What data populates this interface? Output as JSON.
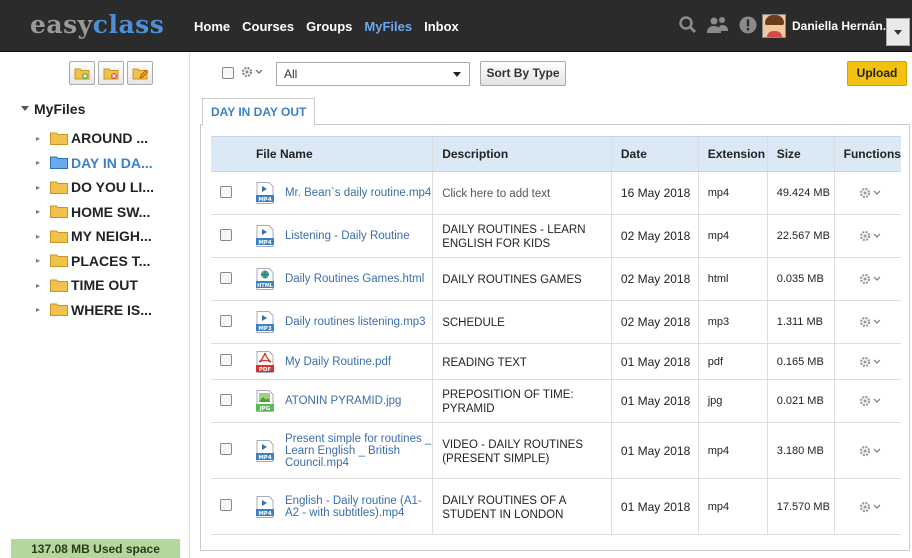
{
  "app": {
    "logo_part1": "easy",
    "logo_part2": "class",
    "nav": [
      "Home",
      "Courses",
      "Groups",
      "MyFiles",
      "Inbox"
    ],
    "active_nav": "MyFiles",
    "user_name": "Daniella Hernán..."
  },
  "sidebar": {
    "root_label": "MyFiles",
    "folders": [
      {
        "label": "AROUND ...",
        "active": false
      },
      {
        "label": "DAY IN DA...",
        "active": true
      },
      {
        "label": "DO YOU LI...",
        "active": false
      },
      {
        "label": "HOME SW...",
        "active": false
      },
      {
        "label": "MY NEIGH...",
        "active": false
      },
      {
        "label": "PLACES T...",
        "active": false
      },
      {
        "label": "TIME OUT",
        "active": false
      },
      {
        "label": "WHERE IS...",
        "active": false
      }
    ],
    "used_space": "137.08 MB Used space"
  },
  "toolbar": {
    "filter_value": "All",
    "sort_label": "Sort By Type",
    "upload_label": "Upload"
  },
  "tab": {
    "label": "DAY IN DAY OUT"
  },
  "table": {
    "headers": [
      "File Name",
      "Description",
      "Date",
      "Extension",
      "Size",
      "Functions"
    ],
    "rows": [
      {
        "name": "Mr. Bean`s daily routine.mp4",
        "description": "Click here to add text",
        "placeholder": true,
        "date": "16 May 2018",
        "ext": "mp4",
        "size": "49.424 MB",
        "icon": "mp4",
        "icon_label": "MP4"
      },
      {
        "name": "Listening - Daily Routine",
        "description": "DAILY ROUTINES - LEARN ENGLISH FOR KIDS",
        "placeholder": false,
        "date": "02 May 2018",
        "ext": "mp4",
        "size": "22.567 MB",
        "icon": "mp4",
        "icon_label": "MP4"
      },
      {
        "name": "Daily Routines Games.html",
        "description": "DAILY ROUTINES GAMES",
        "placeholder": false,
        "date": "02 May 2018",
        "ext": "html",
        "size": "0.035 MB",
        "icon": "html",
        "icon_label": "HTML"
      },
      {
        "name": "Daily routines listening.mp3",
        "description": "SCHEDULE",
        "placeholder": false,
        "date": "02 May 2018",
        "ext": "mp3",
        "size": "1.311 MB",
        "icon": "mp3",
        "icon_label": "MP3"
      },
      {
        "name": "My Daily Routine.pdf",
        "description": "READING TEXT",
        "placeholder": false,
        "date": "01 May 2018",
        "ext": "pdf",
        "size": "0.165 MB",
        "icon": "pdf",
        "icon_label": "PDF"
      },
      {
        "name": "ATONIN PYRAMID.jpg",
        "description": "PREPOSITION OF TIME: PYRAMID",
        "placeholder": false,
        "date": "01 May 2018",
        "ext": "jpg",
        "size": "0.021 MB",
        "icon": "jpg",
        "icon_label": "JPG"
      },
      {
        "name": "Present simple for routines _ Learn English _ British Council.mp4",
        "description": "VIDEO - DAILY ROUTINES (PRESENT SIMPLE)",
        "placeholder": false,
        "date": "01 May 2018",
        "ext": "mp4",
        "size": "3.180 MB",
        "icon": "mp4",
        "icon_label": "MP4"
      },
      {
        "name": "English - Daily routine (A1-A2 - with subtitles).mp4",
        "description": "DAILY ROUTINES OF A STUDENT IN LONDON",
        "placeholder": false,
        "date": "01 May 2018",
        "ext": "mp4",
        "size": "17.570 MB",
        "icon": "mp4",
        "icon_label": "MP4"
      }
    ]
  },
  "colors": {
    "topbar": "#2b2b2b",
    "accent_blue": "#3b82c4",
    "upload_yellow": "#f4c10f",
    "used_space_green": "#b4d89c",
    "table_header": "#dbe9f6"
  }
}
